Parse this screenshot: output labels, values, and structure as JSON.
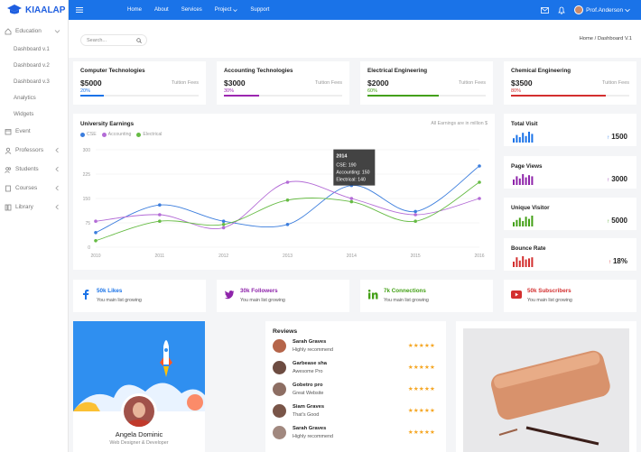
{
  "brand": {
    "name": "KIAALAP"
  },
  "sidebar": {
    "items": [
      {
        "label": "Education"
      },
      {
        "label": "Dashboard v.1"
      },
      {
        "label": "Dashboard v.2"
      },
      {
        "label": "Dashboard v.3"
      },
      {
        "label": "Analytics"
      },
      {
        "label": "Widgets"
      },
      {
        "label": "Event"
      },
      {
        "label": "Professors"
      },
      {
        "label": "Students"
      },
      {
        "label": "Courses"
      },
      {
        "label": "Library"
      }
    ]
  },
  "topbar": {
    "menu": [
      {
        "label": "Home"
      },
      {
        "label": "About"
      },
      {
        "label": "Services"
      },
      {
        "label": "Project"
      },
      {
        "label": "Support"
      }
    ],
    "user": "Prof.Anderson"
  },
  "search": {
    "placeholder": "Search..."
  },
  "breadcrumb": "Home / Dashboard V.1",
  "courses": [
    {
      "title": "Computer Technologies",
      "price": "$5000",
      "fee": "Tuition Fees",
      "percent_label": "20%",
      "progress": 0.2,
      "color": "#1a73e8"
    },
    {
      "title": "Accounting Technologies",
      "price": "$3000",
      "fee": "Tuition Fees",
      "percent_label": "30%",
      "progress": 0.3,
      "color": "#9c27b0"
    },
    {
      "title": "Electrical Engineering",
      "price": "$2000",
      "fee": "Tuition Fees",
      "percent_label": "60%",
      "progress": 0.6,
      "color": "#43a016"
    },
    {
      "title": "Chemical Engineering",
      "price": "$3500",
      "fee": "Tuition Fees",
      "percent_label": "80%",
      "progress": 0.8,
      "color": "#d32f2f"
    }
  ],
  "chart_data": {
    "type": "line",
    "title": "University Earnings",
    "note": "All Earnings are in million $",
    "x": [
      "2010",
      "2011",
      "2012",
      "2013",
      "2014",
      "2015",
      "2016"
    ],
    "ylim": [
      0,
      300
    ],
    "yticks": [
      "0",
      "75",
      "150",
      "225",
      "300"
    ],
    "series": [
      {
        "name": "CSE",
        "color": "#3b7ddd",
        "values": [
          45,
          130,
          80,
          70,
          190,
          110,
          250
        ]
      },
      {
        "name": "Accounting",
        "color": "#b36bd6",
        "values": [
          80,
          100,
          60,
          200,
          150,
          100,
          150
        ]
      },
      {
        "name": "Electrical",
        "color": "#66bb44",
        "values": [
          20,
          80,
          70,
          145,
          140,
          80,
          200
        ]
      }
    ],
    "tooltip": {
      "title": "2014",
      "lines": [
        "CSE: 190",
        "Accounting: 150",
        "Electrical: 140"
      ]
    },
    "grid": true,
    "legend": "top-left"
  },
  "stats": [
    {
      "title": "Total Visit",
      "value": "1500",
      "color": "#1a73e8",
      "bars": [
        4,
        7,
        5,
        9,
        6,
        10,
        8
      ]
    },
    {
      "title": "Page Views",
      "value": "3000",
      "color": "#8e24aa",
      "bars": [
        5,
        8,
        6,
        10,
        7,
        9,
        8
      ]
    },
    {
      "title": "Unique Visitor",
      "value": "5000",
      "color": "#43a016",
      "bars": [
        4,
        6,
        8,
        5,
        9,
        7,
        10
      ]
    },
    {
      "title": "Bounce Rate",
      "value": "18%",
      "color": "#d32f2f",
      "bars": [
        5,
        9,
        6,
        10,
        7,
        8,
        9
      ]
    }
  ],
  "social": [
    {
      "title": "50k Likes",
      "sub": "You main list growing",
      "color": "#1a73e8",
      "icon": "facebook-icon"
    },
    {
      "title": "30k Followers",
      "sub": "You main list growing",
      "color": "#8e24aa",
      "icon": "twitter-icon"
    },
    {
      "title": "7k Connections",
      "sub": "You main list growing",
      "color": "#43a016",
      "icon": "linkedin-icon"
    },
    {
      "title": "50k Subscribers",
      "sub": "You main list growing",
      "color": "#d32f2f",
      "icon": "youtube-icon"
    }
  ],
  "profile": {
    "name": "Angela Dominic",
    "role": "Web Designer & Developer"
  },
  "reviews": {
    "title": "Reviews",
    "items": [
      {
        "name": "Sarah Graves",
        "text": "Highly recommend"
      },
      {
        "name": "Garbease sha",
        "text": "Awesome Pro"
      },
      {
        "name": "Gobetro pro",
        "text": "Great Website"
      },
      {
        "name": "Siam Graves",
        "text": "That's Good"
      },
      {
        "name": "Sarah Graves",
        "text": "Highly recommend"
      }
    ]
  }
}
